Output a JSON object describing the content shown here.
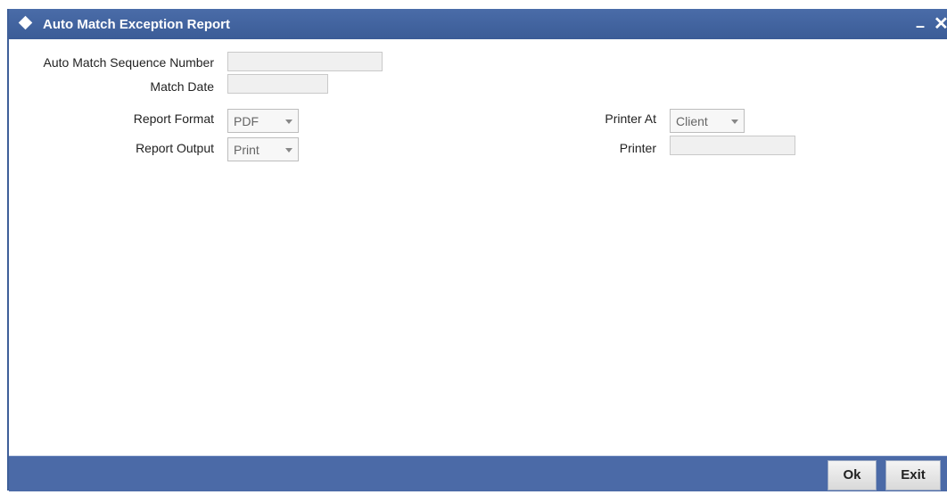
{
  "window": {
    "title": "Auto Match Exception Report",
    "minimize_glyph": "–",
    "close_glyph": "✕"
  },
  "form": {
    "sequence_label": "Auto Match Sequence Number",
    "sequence_value": "",
    "match_date_label": "Match Date",
    "match_date_value": "",
    "report_format_label": "Report Format",
    "report_format_value": "PDF",
    "report_output_label": "Report Output",
    "report_output_value": "Print",
    "printer_at_label": "Printer At",
    "printer_at_value": "Client",
    "printer_label": "Printer",
    "printer_value": ""
  },
  "footer": {
    "ok_label": "Ok",
    "exit_label": "Exit"
  },
  "colors": {
    "titlebar": "#3f5f99",
    "footer": "#4b6aa7"
  }
}
